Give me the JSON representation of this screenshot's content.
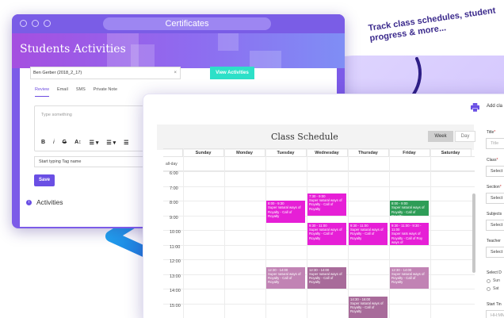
{
  "window": {
    "title": "Certificates"
  },
  "students": {
    "title": "Students Activities",
    "student_select": "Ben Gerber (2018_2_17)",
    "clear_symbol": "×",
    "view_button": "View Activities",
    "tabs": [
      {
        "label": "Review",
        "active": true
      },
      {
        "label": "Email"
      },
      {
        "label": "SMS"
      },
      {
        "label": "Private Note"
      }
    ],
    "editor_placeholder": "Type something",
    "toolbar": [
      "B",
      "i",
      "G",
      "A↕",
      "☰ ▾",
      "☰ ▾",
      "☰"
    ],
    "tag_placeholder": "Start typing Tag name",
    "save_label": "Save",
    "activities_label": "Activities"
  },
  "tagline": "Track class schedules, student progress & more...",
  "schedule": {
    "title": "Class Schedule",
    "view_buttons": {
      "week": "Week",
      "day": "Day"
    },
    "days": [
      "Sunday",
      "Monday",
      "Tuesday",
      "Wednesday",
      "Thursday",
      "Friday",
      "Saturday"
    ],
    "allday_label": "all-day",
    "hours": [
      "6:00",
      "7:00",
      "8:00",
      "9:00",
      "10:00",
      "11:00",
      "12:00",
      "13:00",
      "14:00",
      "15:00"
    ],
    "events": [
      {
        "day": 3,
        "start": 7.5,
        "end": 9.0,
        "time": "7:30 - 9:00",
        "text": "Super natural ways of Royalty - Call of Royalty",
        "color": "#e61fd6"
      },
      {
        "day": 2,
        "start": 8.0,
        "end": 9.5,
        "time": "8:00 - 9:30",
        "text": "Super natural ways of Royalty - Call of Royalty",
        "color": "#e61fd6"
      },
      {
        "day": 5,
        "start": 8.0,
        "end": 9.0,
        "time": "8:00 - 9:00",
        "text": "Super natural ways of Royalty - Call of Royalty",
        "color": "#2e9d57"
      },
      {
        "day": 3,
        "start": 9.5,
        "end": 11.0,
        "time": "9:30 - 11:00",
        "text": "Super natural ways of Royalty - Call of Royalty",
        "color": "#e61fd6"
      },
      {
        "day": 4,
        "start": 9.5,
        "end": 11.0,
        "time": "9:30 - 11:00",
        "text": "Super natural ways of Royalty - Call of Royalty",
        "color": "#e61fd6"
      },
      {
        "day": 5,
        "start": 9.5,
        "end": 11.0,
        "time": "9:30 - 11:00 - 9:30 - 11:00",
        "text": "Super nats ways of Royalty - Call of Roy ways of",
        "color": "#e61fd6"
      },
      {
        "day": 2,
        "start": 12.5,
        "end": 14.0,
        "time": "12:30 - 14:00",
        "text": "Super natural ways of Royalty - Call of Royalty",
        "color": "#c183b4"
      },
      {
        "day": 3,
        "start": 12.5,
        "end": 14.0,
        "time": "12:30 - 14:00",
        "text": "Super natural ways of Royalty - Call of Royalty",
        "color": "#a86b9a"
      },
      {
        "day": 5,
        "start": 12.5,
        "end": 14.0,
        "time": "12:30 - 14:00",
        "text": "Super natural ways of Royalty - Call of Royalty",
        "color": "#c183b4"
      },
      {
        "day": 4,
        "start": 14.5,
        "end": 16.0,
        "time": "14:30 - 16:00",
        "text": "Super natural ways of Royalty - Call of Royalty",
        "color": "#a86b9a"
      }
    ]
  },
  "form": {
    "heading": "Add cla",
    "title_label": "Title",
    "title_placeholder": "Title",
    "class_label": "Class",
    "class_value": "Select",
    "section_label": "Section",
    "section_value": "Select",
    "subjects_label": "Subjects",
    "subjects_value": "Select",
    "teachers_label": "Teacher",
    "teachers_value": "Select",
    "select_days_label": "Select D",
    "day_options": [
      "Sun",
      "Sat"
    ],
    "start_time_label": "Start Tin",
    "start_time_placeholder": "HH:MM"
  }
}
